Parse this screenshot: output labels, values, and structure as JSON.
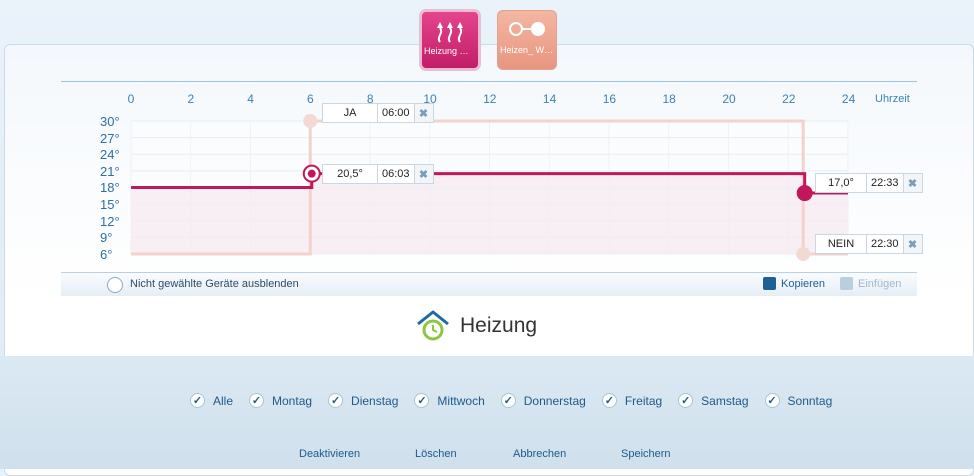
{
  "devices": [
    {
      "label": "Heizung WOHNZIM...",
      "icon": "heating-waves-icon",
      "state": "selected"
    },
    {
      "label": "Heizen_ WOHNZIM...",
      "icon": "switch-toggle-icon",
      "state": "unselected"
    }
  ],
  "chart": {
    "x_ticks": [
      "0",
      "2",
      "4",
      "6",
      "8",
      "10",
      "12",
      "14",
      "16",
      "18",
      "20",
      "22",
      "24"
    ],
    "x_unit": "Uhrzeit",
    "y_ticks": [
      "30°",
      "27°",
      "24°",
      "21°",
      "18°",
      "15°",
      "12°",
      "9°",
      "6°"
    ]
  },
  "chart_data": {
    "type": "line",
    "xlim": [
      0,
      24
    ],
    "ylim": [
      6,
      30
    ],
    "series": [
      {
        "points": [
          [
            0,
            18
          ],
          [
            6.05,
            18
          ],
          [
            6.05,
            20.5
          ],
          [
            22.55,
            20.5
          ],
          [
            22.55,
            17
          ],
          [
            24,
            17
          ]
        ]
      },
      {
        "points": [
          [
            0,
            6
          ],
          [
            6,
            6
          ],
          [
            6,
            30
          ],
          [
            22.5,
            30
          ],
          [
            22.5,
            6
          ],
          [
            24,
            6
          ]
        ]
      }
    ]
  },
  "schedule": {
    "switch_on": {
      "value": "JA",
      "time": "06:00"
    },
    "temp_set": {
      "value": "20,5°",
      "time": "06:03"
    },
    "temp_end": {
      "value": "17,0°",
      "time": "22:33"
    },
    "switch_off": {
      "value": "NEIN",
      "time": "22:30"
    },
    "delete_glyph": "✖"
  },
  "toolbar": {
    "hide_label": "Nicht gewählte Geräte ausblenden",
    "copy_label": "Kopieren",
    "paste_label": "Einfügen"
  },
  "title": "Heizung",
  "days": [
    "Alle",
    "Montag",
    "Dienstag",
    "Mittwoch",
    "Donnerstag",
    "Freitag",
    "Samstag",
    "Sonntag"
  ],
  "actions": {
    "deactivate": "Deaktivieren",
    "delete": "Löschen",
    "cancel": "Abbrechen",
    "save": "Speichern"
  },
  "colors": {
    "accent": "#c2185b",
    "switch_line": "#f4d1cb",
    "link": "#1d5a8c"
  }
}
